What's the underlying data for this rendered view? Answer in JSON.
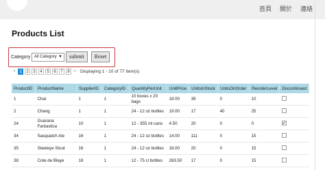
{
  "nav": {
    "items": [
      "首頁",
      "關於",
      "連絡"
    ]
  },
  "page": {
    "title": "Products List"
  },
  "filter": {
    "label": "Category :",
    "selected": "All Category",
    "submit_label": "submit",
    "reset_label": "Reset"
  },
  "pager": {
    "prev": "«",
    "pages": [
      "1",
      "2",
      "3",
      "4",
      "5",
      "6",
      "7",
      "8"
    ],
    "active_page": "1",
    "next": "»",
    "info": "Displaying 1 - 10 of 77 item(s)"
  },
  "table": {
    "columns": [
      "ProductID",
      "ProductName",
      "SupplierID",
      "CategoryID",
      "QuantityPerUnit",
      "UnitPrice",
      "UnitsInStock",
      "UnitsOnOrder",
      "ReorderLevel",
      "Discontinued"
    ],
    "rows": [
      {
        "id": "1",
        "name": "Chai",
        "supplier": "1",
        "category": "1",
        "qty": "10 boxes x 20 bags",
        "price": "18.00",
        "stock": "39",
        "order": "0",
        "reorder": "10",
        "discontinued": false
      },
      {
        "id": "2",
        "name": "Chang",
        "supplier": "1",
        "category": "1",
        "qty": "24 - 12 oz bottles",
        "price": "19.00",
        "stock": "17",
        "order": "40",
        "reorder": "25",
        "discontinued": false
      },
      {
        "id": "24",
        "name": "Guarana Fantastica",
        "supplier": "10",
        "category": "1",
        "qty": "12 - 355 ml cans",
        "price": "4.50",
        "stock": "20",
        "order": "0",
        "reorder": "0",
        "discontinued": true
      },
      {
        "id": "34",
        "name": "Sasquatch Ale",
        "supplier": "16",
        "category": "1",
        "qty": "24 - 12 oz bottles",
        "price": "14.00",
        "stock": "111",
        "order": "0",
        "reorder": "15",
        "discontinued": false
      },
      {
        "id": "35",
        "name": "Steeleye Stout",
        "supplier": "16",
        "category": "1",
        "qty": "24 - 12 oz bottles",
        "price": "18.00",
        "stock": "20",
        "order": "0",
        "reorder": "15",
        "discontinued": false
      },
      {
        "id": "38",
        "name": "Cote de Blaye",
        "supplier": "18",
        "category": "1",
        "qty": "12 - 75 cl bottles",
        "price": "263.50",
        "stock": "17",
        "order": "0",
        "reorder": "15",
        "discontinued": false
      }
    ]
  }
}
